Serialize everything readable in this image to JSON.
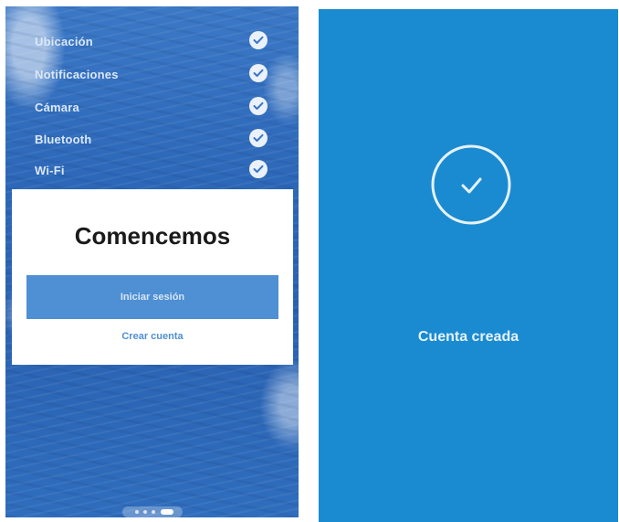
{
  "onboarding": {
    "permissions": [
      {
        "label": "Ubicación",
        "icon": "check-circle-icon"
      },
      {
        "label": "Notificaciones",
        "icon": "check-circle-icon"
      },
      {
        "label": "Cámara",
        "icon": "check-circle-icon"
      },
      {
        "label": "Bluetooth",
        "icon": "check-circle-icon"
      },
      {
        "label": "Wi-Fi",
        "icon": "check-circle-icon"
      }
    ],
    "card": {
      "title": "Comencemos",
      "primary_label": "Iniciar sesión",
      "secondary_label": "Crear cuenta"
    },
    "pager": {
      "pages": 4,
      "active_page": 4
    }
  },
  "confirmation": {
    "message": "Cuenta creada",
    "icon": "check-circle-icon"
  },
  "colors": {
    "accent": "#4f8fd3",
    "confirmation_bg": "#1a8bd0"
  }
}
